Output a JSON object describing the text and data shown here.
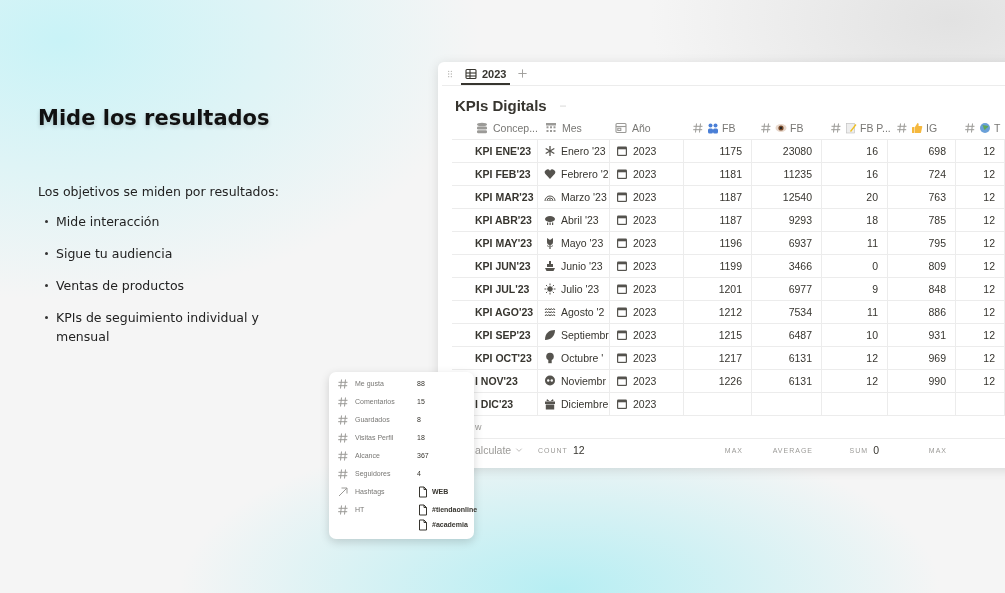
{
  "left": {
    "heading": "Mide los resultados",
    "intro": "Los objetivos se miden por resultados:",
    "bullets": [
      "Mide interacción",
      "Sigue tu audiencia",
      "Ventas de productos",
      "KPIs de seguimiento individual y mensual"
    ]
  },
  "tab": {
    "label": "2023",
    "selected": true
  },
  "title": "KPIs Digitals",
  "columns": [
    {
      "label": "Concep...",
      "kind": "title"
    },
    {
      "label": "Mes",
      "kind": "month"
    },
    {
      "label": "Año",
      "kind": "date"
    },
    {
      "label": "FB",
      "kind": "number"
    },
    {
      "label": "FB",
      "kind": "number"
    },
    {
      "label": "FB P...",
      "kind": "number"
    },
    {
      "label": "IG",
      "kind": "number"
    },
    {
      "label": "T",
      "kind": "number"
    }
  ],
  "rows": [
    {
      "concept": "KPI ENE'23",
      "month": "Enero '23",
      "year": "2023",
      "values": [
        "1175",
        "23080",
        "16",
        "698",
        "12"
      ]
    },
    {
      "concept": "KPI FEB'23",
      "month": "Febrero '2",
      "year": "2023",
      "values": [
        "1181",
        "11235",
        "16",
        "724",
        "12"
      ]
    },
    {
      "concept": "KPI MAR'23",
      "month": "Marzo '23",
      "year": "2023",
      "values": [
        "1187",
        "12540",
        "20",
        "763",
        "12"
      ]
    },
    {
      "concept": "KPI ABR'23",
      "month": "Abril '23",
      "year": "2023",
      "values": [
        "1187",
        "9293",
        "18",
        "785",
        "12"
      ]
    },
    {
      "concept": "KPI MAY'23",
      "month": "Mayo '23",
      "year": "2023",
      "values": [
        "1196",
        "6937",
        "11",
        "795",
        "12"
      ]
    },
    {
      "concept": "KPI JUN'23",
      "month": "Junio '23",
      "year": "2023",
      "values": [
        "1199",
        "3466",
        "0",
        "809",
        "12"
      ]
    },
    {
      "concept": "KPI JUL'23",
      "month": "Julio '23",
      "year": "2023",
      "values": [
        "1201",
        "6977",
        "9",
        "848",
        "12"
      ]
    },
    {
      "concept": "KPI AGO'23",
      "month": "Agosto '2",
      "year": "2023",
      "values": [
        "1212",
        "7534",
        "11",
        "886",
        "12"
      ]
    },
    {
      "concept": "KPI SEP'23",
      "month": "Septiembr",
      "year": "2023",
      "values": [
        "1215",
        "6487",
        "10",
        "931",
        "12"
      ]
    },
    {
      "concept": "KPI OCT'23",
      "month": "Octubre '",
      "year": "2023",
      "values": [
        "1217",
        "6131",
        "12",
        "969",
        "12"
      ]
    },
    {
      "concept": "I NOV'23",
      "month": "Noviembr",
      "year": "2023",
      "values": [
        "1226",
        "6131",
        "12",
        "990",
        "12"
      ]
    },
    {
      "concept": "I DIC'23",
      "month": "Diciembre",
      "year": "2023",
      "values": []
    }
  ],
  "new_row": "w",
  "footer": {
    "calculate": "alculate",
    "aggregates": [
      {
        "label": "COUNT",
        "value": "12"
      },
      {
        "label": "MAX"
      },
      {
        "label": "AVERAGE"
      },
      {
        "label": "SUM",
        "value": "0"
      },
      {
        "label": "MAX"
      }
    ]
  },
  "card": {
    "properties": [
      {
        "kind": "number",
        "name": "Me gusta",
        "values": [
          {
            "kind": "plain",
            "text": "88"
          }
        ]
      },
      {
        "kind": "number",
        "name": "Comentarios",
        "values": [
          {
            "kind": "plain",
            "text": "15"
          }
        ]
      },
      {
        "kind": "number",
        "name": "Guardados",
        "values": [
          {
            "kind": "plain",
            "text": "8"
          }
        ]
      },
      {
        "kind": "number",
        "name": "Visitas Perfil",
        "values": [
          {
            "kind": "plain",
            "text": "18"
          }
        ]
      },
      {
        "kind": "number",
        "name": "Alcance",
        "values": [
          {
            "kind": "plain",
            "text": "367"
          }
        ]
      },
      {
        "kind": "number",
        "name": "Seguidores",
        "values": [
          {
            "kind": "plain",
            "text": "4"
          }
        ]
      },
      {
        "kind": "relation",
        "name": "Hashtags",
        "values": [
          {
            "kind": "page",
            "text": "WEB"
          }
        ]
      },
      {
        "kind": "number",
        "name": "HT",
        "values": [
          {
            "kind": "page",
            "text": "#tiendaonline"
          },
          {
            "kind": "page",
            "text": "#academia"
          }
        ]
      }
    ]
  }
}
